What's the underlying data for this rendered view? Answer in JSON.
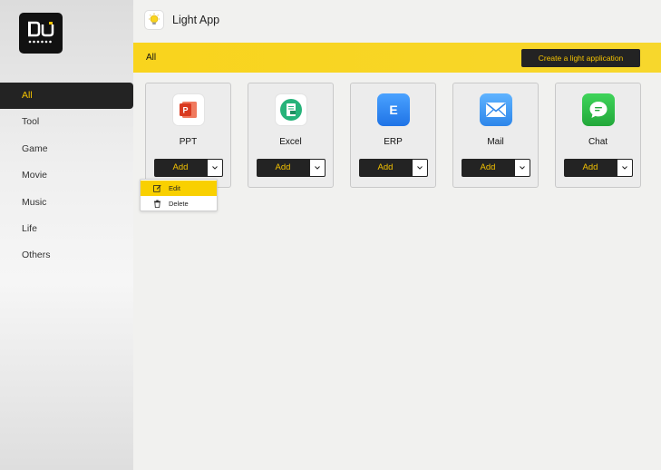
{
  "header": {
    "title": "Light App",
    "icon": "lightbulb-icon"
  },
  "sidebar": {
    "logo_text": "DU",
    "items": [
      {
        "label": "All",
        "active": true
      },
      {
        "label": "Tool"
      },
      {
        "label": "Game"
      },
      {
        "label": "Movie"
      },
      {
        "label": "Music"
      },
      {
        "label": "Life"
      },
      {
        "label": "Others"
      }
    ]
  },
  "category": {
    "current": "All",
    "create_label": "Create a light application"
  },
  "apps": [
    {
      "name": "PPT",
      "add_label": "Add",
      "icon": "powerpoint-icon",
      "color": "#e0452c",
      "glyph": "P"
    },
    {
      "name": "Excel",
      "add_label": "Add",
      "icon": "excel-icon",
      "color": "#26b37a",
      "glyph": "E"
    },
    {
      "name": "ERP",
      "add_label": "Add",
      "icon": "erp-icon",
      "color": "#2f8bf0",
      "glyph": "E"
    },
    {
      "name": "Mail",
      "add_label": "Add",
      "icon": "mail-icon",
      "color": "#3c9df3",
      "glyph": ""
    },
    {
      "name": "Chat",
      "add_label": "Add",
      "icon": "chat-icon",
      "color": "#2fbf4a",
      "glyph": ""
    }
  ],
  "dropdown": {
    "items": [
      {
        "label": "Edit",
        "icon": "edit-icon",
        "highlighted": true
      },
      {
        "label": "Delete",
        "icon": "trash-icon"
      }
    ]
  },
  "colors": {
    "accent": "#f5c300",
    "dark": "#232323",
    "bar": "#f9d41d"
  }
}
